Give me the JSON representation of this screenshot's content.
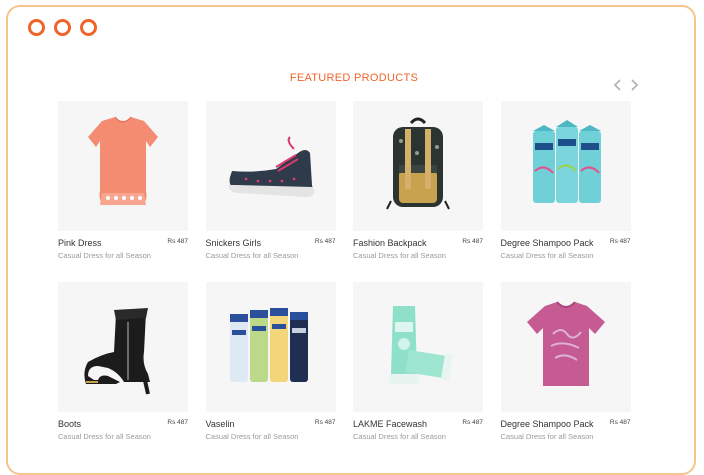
{
  "colors": {
    "accent": "#f0642a",
    "frame": "#f6c48f",
    "thumb_bg": "#f6f6f6"
  },
  "window": {
    "controls": [
      "circle-icon",
      "circle-icon",
      "circle-icon"
    ]
  },
  "section": {
    "title": "FEATURED PRODUCTS",
    "prev_icon": "chevron-left-icon",
    "next_icon": "chevron-right-icon"
  },
  "products": [
    {
      "name": "Pink Dress",
      "price": "Rs 487",
      "subtitle": "Casual Dress for all Season",
      "image": "top-shirt"
    },
    {
      "name": "Snickers Girls",
      "price": "Rs 487",
      "subtitle": "Casual Dress for all Season",
      "image": "sneaker"
    },
    {
      "name": "Fashion Backpack",
      "price": "Rs 487",
      "subtitle": "Casual Dress for all Season",
      "image": "backpack"
    },
    {
      "name": "Degree Shampoo Pack",
      "price": "Rs 487",
      "subtitle": "Casual Dress for all Season",
      "image": "deodorant-pack"
    },
    {
      "name": "Boots",
      "price": "Rs 487",
      "subtitle": "Casual Dress for all Season",
      "image": "ankle-boot"
    },
    {
      "name": "Vaselin",
      "price": "Rs 487",
      "subtitle": "Casual Dress for all Season",
      "image": "lotion-bottles"
    },
    {
      "name": "LAKME Facewash",
      "price": "Rs 487",
      "subtitle": "Casual Dress for all Season",
      "image": "facewash-tubes"
    },
    {
      "name": "Degree Shampoo Pack",
      "price": "Rs 487",
      "subtitle": "Casual Dress for all Season",
      "image": "pink-tshirt"
    }
  ]
}
